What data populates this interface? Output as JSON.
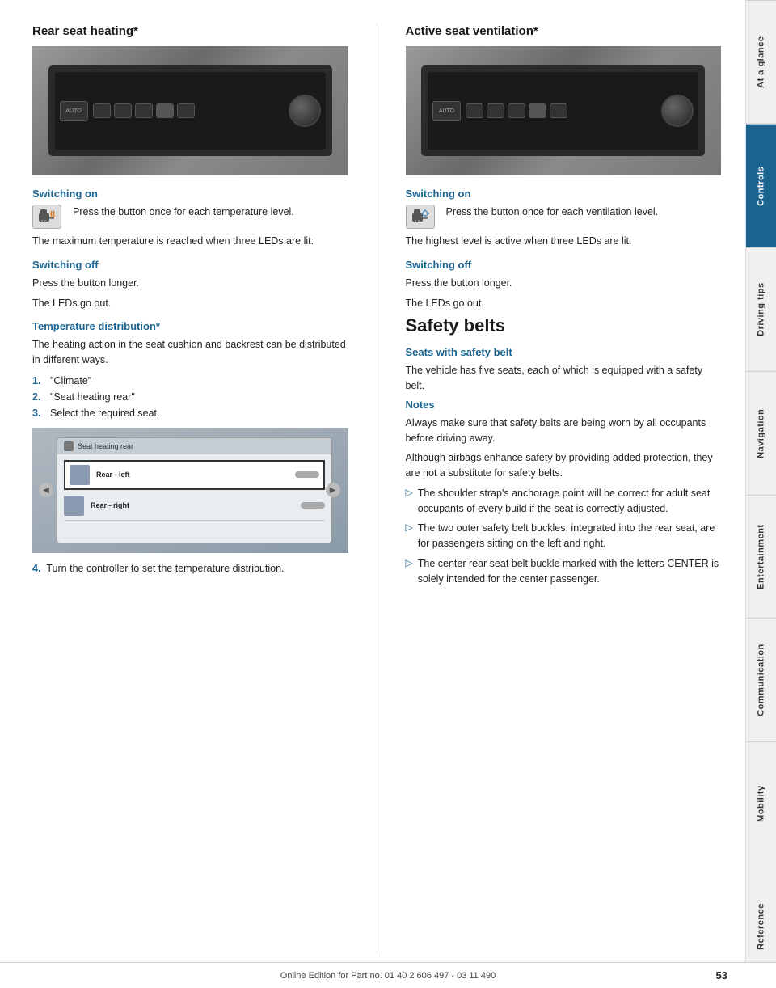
{
  "left_col": {
    "title": "Rear seat heating*",
    "switching_on_title": "Switching on",
    "switching_on_icon_desc": "seat-heat-icon",
    "switching_on_text": "Press the button once for each temperature level.",
    "switching_on_note": "The maximum temperature is reached when three LEDs are lit.",
    "switching_off_title": "Switching off",
    "switching_off_text1": "Press the button longer.",
    "switching_off_text2": "The LEDs go out.",
    "temp_dist_title": "Temperature distribution*",
    "temp_dist_intro": "The heating action in the seat cushion and backrest can be distributed in different ways.",
    "list_items": [
      {
        "num": "1.",
        "text": "\"Climate\""
      },
      {
        "num": "2.",
        "text": "\"Seat heating rear\""
      },
      {
        "num": "3.",
        "text": "Select the required seat."
      }
    ],
    "screen_header": "Seat heating rear",
    "screen_row1": "Rear - left",
    "screen_row2": "Rear - right",
    "step4_text": "Turn the controller to set the temperature distribution."
  },
  "right_col": {
    "title": "Active seat ventilation*",
    "switching_on_title": "Switching on",
    "switching_on_text": "Press the button once for each ventilation level.",
    "switching_on_note": "The highest level is active when three LEDs are lit.",
    "switching_off_title": "Switching off",
    "switching_off_text1": "Press the button longer.",
    "switching_off_text2": "The LEDs go out.",
    "safety_title": "Safety belts",
    "seats_title": "Seats with safety belt",
    "seats_text": "The vehicle has five seats, each of which is equipped with a safety belt.",
    "notes_title": "Notes",
    "notes_text1": "Always make sure that safety belts are being worn by all occupants before driving away.",
    "notes_text2": "Although airbags enhance safety by providing added protection, they are not a substitute for safety belts.",
    "bullets": [
      "The shoulder strap's anchorage point will be correct for adult seat occupants of every build if the seat is correctly adjusted.",
      "The two outer safety belt buckles, integrated into the rear seat, are for passengers sitting on the left and right.",
      "The center rear seat belt buckle marked with the letters CENTER is solely intended for the center passenger."
    ]
  },
  "sidebar": {
    "items": [
      {
        "label": "At a glance",
        "active": false
      },
      {
        "label": "Controls",
        "active": true
      },
      {
        "label": "Driving tips",
        "active": false
      },
      {
        "label": "Navigation",
        "active": false
      },
      {
        "label": "Entertainment",
        "active": false
      },
      {
        "label": "Communication",
        "active": false
      },
      {
        "label": "Mobility",
        "active": false
      },
      {
        "label": "Reference",
        "active": false
      }
    ]
  },
  "footer": {
    "text": "Online Edition for Part no. 01 40 2 606 497 - 03 11 490",
    "page": "53"
  }
}
